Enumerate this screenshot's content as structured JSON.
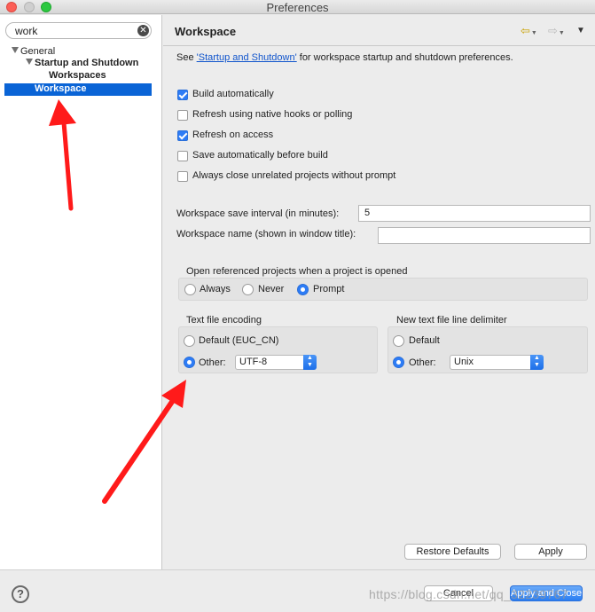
{
  "window": {
    "title": "Preferences"
  },
  "filter": {
    "value": "work",
    "clear_icon": "clear-x-icon"
  },
  "tree": {
    "items": [
      {
        "label": "General",
        "expanded": true
      },
      {
        "label": "Startup and Shutdown",
        "expanded": true
      },
      {
        "label": "Workspaces"
      },
      {
        "label": "Workspace",
        "selected": true
      }
    ]
  },
  "page": {
    "title": "Workspace",
    "see_prefix": "See ",
    "see_link": "'Startup and Shutdown'",
    "see_suffix": " for workspace startup and shutdown preferences.",
    "checkboxes": [
      {
        "label": "Build automatically",
        "checked": true
      },
      {
        "label": "Refresh using native hooks or polling",
        "checked": false
      },
      {
        "label": "Refresh on access",
        "checked": true
      },
      {
        "label": "Save automatically before build",
        "checked": false
      },
      {
        "label": "Always close unrelated projects without prompt",
        "checked": false
      }
    ],
    "save_interval": {
      "label": "Workspace save interval (in minutes):",
      "value": "5"
    },
    "workspace_name": {
      "label": "Workspace name (shown in window title):",
      "value": ""
    },
    "open_referenced": {
      "label": "Open referenced projects when a project is opened",
      "options": [
        {
          "label": "Always",
          "selected": false
        },
        {
          "label": "Never",
          "selected": false
        },
        {
          "label": "Prompt",
          "selected": true
        }
      ]
    },
    "encoding": {
      "label": "Text file encoding",
      "default_label": "Default (EUC_CN)",
      "other_label": "Other:",
      "other_value": "UTF-8",
      "selected": "other"
    },
    "line_delimiter": {
      "label": "New text file line delimiter",
      "default_label": "Default",
      "other_label": "Other:",
      "other_value": "Unix",
      "selected": "other"
    },
    "restore_defaults": "Restore Defaults",
    "apply": "Apply"
  },
  "footer": {
    "help_icon": "question-mark-icon",
    "help_glyph": "?",
    "cancel": "Cancel",
    "apply_and_close": "Apply and Close",
    "watermark": "https://blog.csdn.net/qq_32239767"
  },
  "colors": {
    "selection": "#0a64d6",
    "accent": "#2d7cf6",
    "annotation_arrow": "#ff1a1a"
  }
}
